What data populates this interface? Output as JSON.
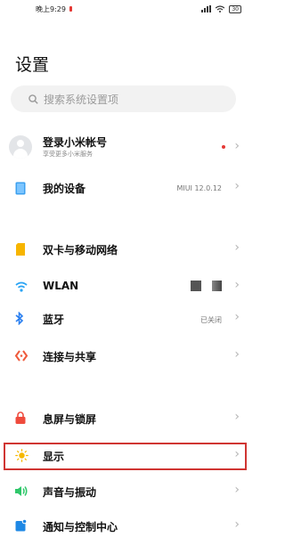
{
  "status": {
    "time": "晚上9:29",
    "battery": "30"
  },
  "page_title": "设置",
  "search": {
    "placeholder": "搜索系统设置项"
  },
  "account": {
    "title": "登录小米帐号",
    "subtitle": "享受更多小米服务"
  },
  "my_device": {
    "label": "我的设备",
    "value": "MIUI 12.0.12"
  },
  "items": [
    {
      "label": "双卡与移动网络",
      "icon": "sim-card-icon",
      "color": "#f7b500"
    },
    {
      "label": "WLAN",
      "icon": "wifi-icon",
      "color": "#2aa4f4"
    },
    {
      "label": "蓝牙",
      "icon": "bluetooth-icon",
      "color": "#2a7ff0",
      "value": "已关闭"
    },
    {
      "label": "连接与共享",
      "icon": "connection-share-icon",
      "color": "#ef5a3c"
    },
    {
      "label": "息屏与锁屏",
      "icon": "lock-screen-icon",
      "color": "#ef4b3d"
    },
    {
      "label": "显示",
      "icon": "sun-icon",
      "color": "#f6b800"
    },
    {
      "label": "声音与振动",
      "icon": "sound-icon",
      "color": "#2fc76a"
    },
    {
      "label": "通知与控制中心",
      "icon": "notification-icon",
      "color": "#1e88e5"
    }
  ]
}
